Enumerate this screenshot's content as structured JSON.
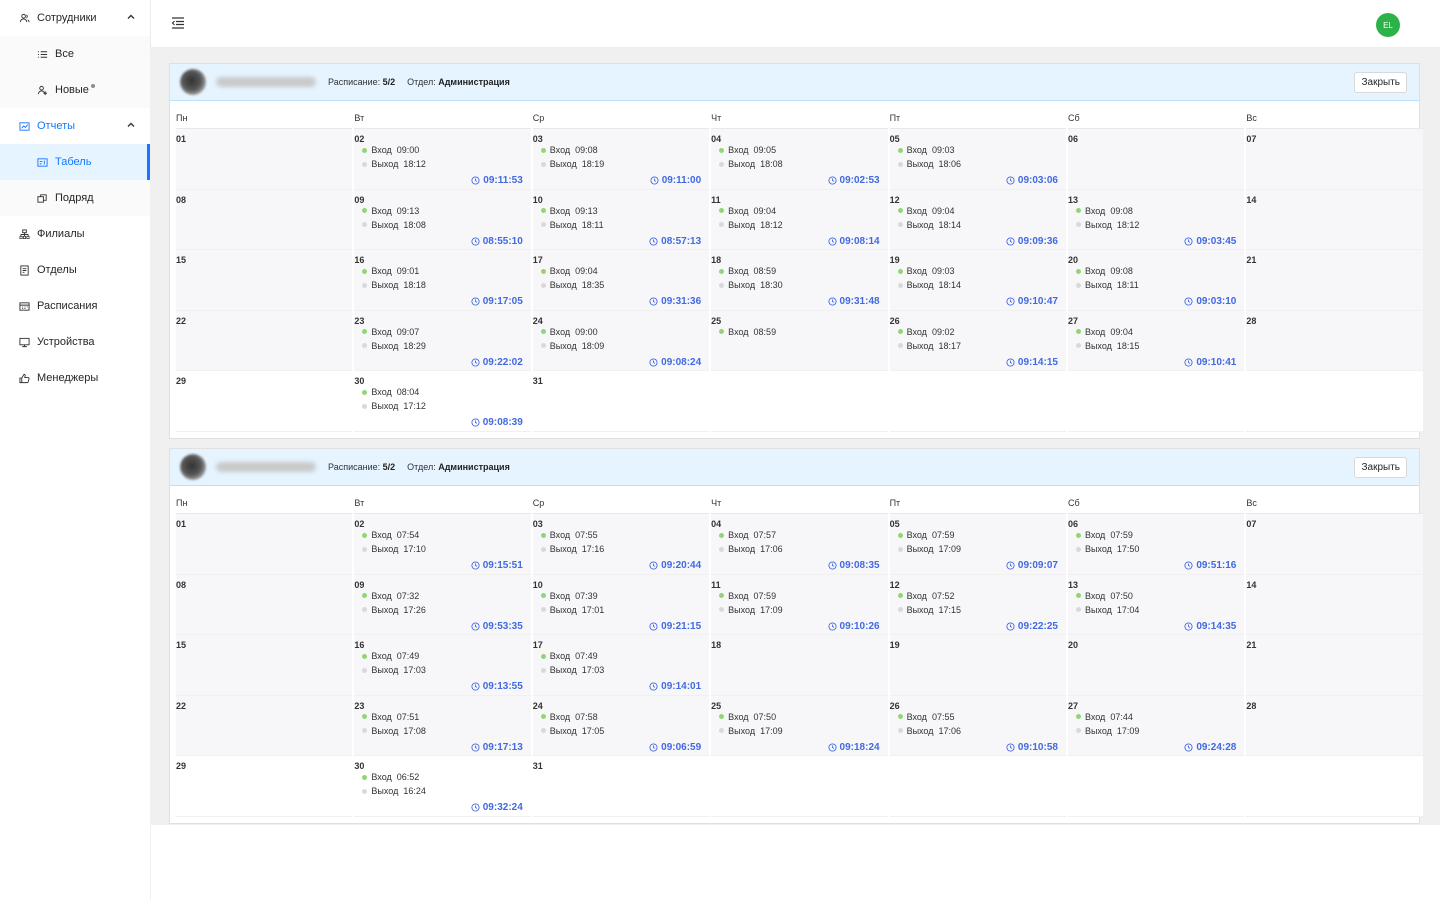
{
  "sidebar": {
    "items": [
      {
        "label": "Сотрудники",
        "icon": "users-icon",
        "expanded": true
      },
      {
        "label": "Все",
        "icon": "list-icon"
      },
      {
        "label": "Новые",
        "icon": "user-add-icon"
      },
      {
        "label": "Отчеты",
        "icon": "chart-icon",
        "expanded": true
      },
      {
        "label": "Табель",
        "icon": "table-icon"
      },
      {
        "label": "Подряд",
        "icon": "copy-icon"
      },
      {
        "label": "Филиалы",
        "icon": "branch-icon"
      },
      {
        "label": "Отделы",
        "icon": "department-icon"
      },
      {
        "label": "Расписания",
        "icon": "schedule-icon"
      },
      {
        "label": "Устройства",
        "icon": "desktop-icon"
      },
      {
        "label": "Менеджеры",
        "icon": "thumbs-up-icon"
      }
    ]
  },
  "header": {
    "avatar_initials": "EL"
  },
  "labels": {
    "schedule": "Расписание:",
    "department": "Отдел:",
    "close": "Закрыть",
    "in": "Вход",
    "out": "Выход",
    "weekdays": [
      "Пн",
      "Вт",
      "Ср",
      "Чт",
      "Пт",
      "Сб",
      "Вс"
    ]
  },
  "employees": [
    {
      "schedule": "5/2",
      "department": "Администрация",
      "days": {
        "02": {
          "in": "09:00",
          "out": "18:12",
          "dur": "09:11:53"
        },
        "03": {
          "in": "09:08",
          "out": "18:19",
          "dur": "09:11:00"
        },
        "04": {
          "in": "09:05",
          "out": "18:08",
          "dur": "09:02:53"
        },
        "05": {
          "in": "09:03",
          "out": "18:06",
          "dur": "09:03:06"
        },
        "09": {
          "in": "09:13",
          "out": "18:08",
          "dur": "08:55:10"
        },
        "10": {
          "in": "09:13",
          "out": "18:11",
          "dur": "08:57:13"
        },
        "11": {
          "in": "09:04",
          "out": "18:12",
          "dur": "09:08:14"
        },
        "12": {
          "in": "09:04",
          "out": "18:14",
          "dur": "09:09:36"
        },
        "13": {
          "in": "09:08",
          "out": "18:12",
          "dur": "09:03:45"
        },
        "16": {
          "in": "09:01",
          "out": "18:18",
          "dur": "09:17:05"
        },
        "17": {
          "in": "09:04",
          "out": "18:35",
          "dur": "09:31:36"
        },
        "18": {
          "in": "08:59",
          "out": "18:30",
          "dur": "09:31:48"
        },
        "19": {
          "in": "09:03",
          "out": "18:14",
          "dur": "09:10:47"
        },
        "20": {
          "in": "09:08",
          "out": "18:11",
          "dur": "09:03:10"
        },
        "23": {
          "in": "09:07",
          "out": "18:29",
          "dur": "09:22:02"
        },
        "24": {
          "in": "09:00",
          "out": "18:09",
          "dur": "09:08:24"
        },
        "25": {
          "in": "08:59"
        },
        "26": {
          "in": "09:02",
          "out": "18:17",
          "dur": "09:14:15"
        },
        "27": {
          "in": "09:04",
          "out": "18:15",
          "dur": "09:10:41"
        },
        "30": {
          "in": "08:04",
          "out": "17:12",
          "dur": "09:08:39"
        }
      }
    },
    {
      "schedule": "5/2",
      "department": "Администрация",
      "days": {
        "02": {
          "in": "07:54",
          "out": "17:10",
          "dur": "09:15:51"
        },
        "03": {
          "in": "07:55",
          "out": "17:16",
          "dur": "09:20:44"
        },
        "04": {
          "in": "07:57",
          "out": "17:06",
          "dur": "09:08:35"
        },
        "05": {
          "in": "07:59",
          "out": "17:09",
          "dur": "09:09:07"
        },
        "06": {
          "in": "07:59",
          "out": "17:50",
          "dur": "09:51:16"
        },
        "09": {
          "in": "07:32",
          "out": "17:26",
          "dur": "09:53:35"
        },
        "10": {
          "in": "07:39",
          "out": "17:01",
          "dur": "09:21:15"
        },
        "11": {
          "in": "07:59",
          "out": "17:09",
          "dur": "09:10:26"
        },
        "12": {
          "in": "07:52",
          "out": "17:15",
          "dur": "09:22:25"
        },
        "13": {
          "in": "07:50",
          "out": "17:04",
          "dur": "09:14:35"
        },
        "16": {
          "in": "07:49",
          "out": "17:03",
          "dur": "09:13:55"
        },
        "17": {
          "in": "07:49",
          "out": "17:03",
          "dur": "09:14:01"
        },
        "23": {
          "in": "07:51",
          "out": "17:08",
          "dur": "09:17:13"
        },
        "24": {
          "in": "07:58",
          "out": "17:05",
          "dur": "09:06:59"
        },
        "25": {
          "in": "07:50",
          "out": "17:09",
          "dur": "09:18:24"
        },
        "26": {
          "in": "07:55",
          "out": "17:06",
          "dur": "09:10:58"
        },
        "27": {
          "in": "07:44",
          "out": "17:09",
          "dur": "09:24:28"
        },
        "30": {
          "in": "06:52",
          "out": "16:24",
          "dur": "09:32:24"
        }
      }
    }
  ],
  "calendar": {
    "weeks": [
      [
        "01",
        "02",
        "03",
        "04",
        "05",
        "06",
        "07"
      ],
      [
        "08",
        "09",
        "10",
        "11",
        "12",
        "13",
        "14"
      ],
      [
        "15",
        "16",
        "17",
        "18",
        "19",
        "20",
        "21"
      ],
      [
        "22",
        "23",
        "24",
        "25",
        "26",
        "27",
        "28"
      ],
      [
        "29",
        "30",
        "31",
        "",
        "",
        "",
        ""
      ]
    ]
  }
}
